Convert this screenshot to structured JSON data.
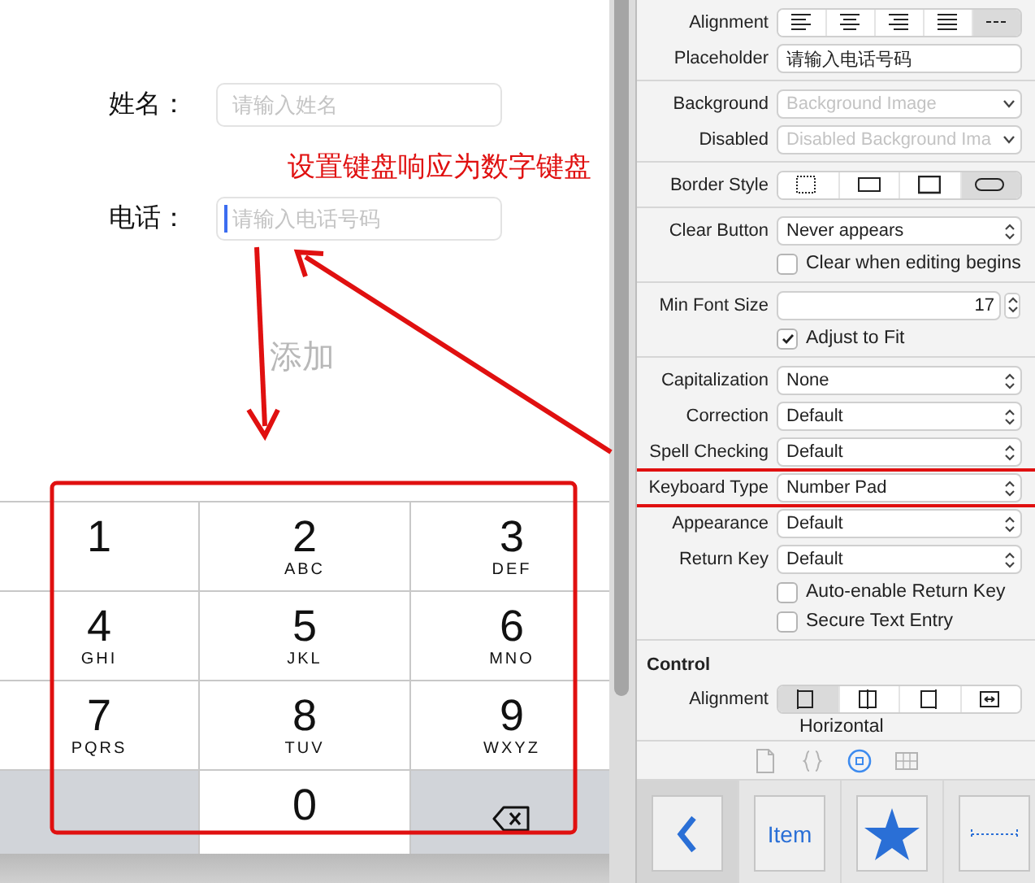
{
  "simulator": {
    "fields": [
      {
        "label": "姓名：",
        "placeholder": "请输入姓名",
        "focused": false
      },
      {
        "label": "电话：",
        "placeholder": "请输入电话号码",
        "focused": true
      }
    ],
    "add_button": "添加",
    "keypad": [
      {
        "kind": "digit",
        "digit": "1"
      },
      {
        "kind": "digit",
        "digit": "2",
        "letters": "ABC"
      },
      {
        "kind": "digit",
        "digit": "3",
        "letters": "DEF"
      },
      {
        "kind": "digit",
        "digit": "4",
        "letters": "GHI"
      },
      {
        "kind": "digit",
        "digit": "5",
        "letters": "JKL"
      },
      {
        "kind": "digit",
        "digit": "6",
        "letters": "MNO"
      },
      {
        "kind": "digit",
        "digit": "7",
        "letters": "PQRS"
      },
      {
        "kind": "digit",
        "digit": "8",
        "letters": "TUV"
      },
      {
        "kind": "digit",
        "digit": "9",
        "letters": "WXYZ"
      },
      {
        "kind": "blank"
      },
      {
        "kind": "digit",
        "digit": "0"
      },
      {
        "kind": "delete"
      }
    ]
  },
  "annotation": {
    "text": "设置键盘响应为数字键盘"
  },
  "inspector": {
    "sections": [
      {
        "rows": [
          {
            "kind": "segmented",
            "label": "Alignment",
            "segments": [
              {
                "selected": false
              },
              {
                "selected": false
              },
              {
                "selected": false
              },
              {
                "selected": false
              },
              {
                "selected": true
              }
            ]
          },
          {
            "kind": "text",
            "label": "Placeholder",
            "value": "请输入电话号码"
          }
        ]
      },
      {
        "rows": [
          {
            "kind": "combo",
            "label": "Background",
            "placeholder": "Background Image"
          },
          {
            "kind": "combo",
            "label": "Disabled",
            "placeholder": "Disabled Background Ima"
          }
        ]
      },
      {
        "rows": [
          {
            "kind": "segmented",
            "label": "Border Style",
            "segments": [
              {
                "selected": false
              },
              {
                "selected": false
              },
              {
                "selected": false
              },
              {
                "selected": true
              }
            ]
          }
        ]
      },
      {
        "rows": [
          {
            "kind": "popup",
            "label": "Clear Button",
            "value": "Never appears",
            "annotated": false
          },
          {
            "kind": "checkbox",
            "label": "Clear when editing begins",
            "checked": false
          }
        ]
      },
      {
        "rows": [
          {
            "kind": "stepper",
            "label": "Min Font Size",
            "value": "17"
          },
          {
            "kind": "checkbox",
            "label": "Adjust to Fit",
            "checked": true
          }
        ]
      },
      {
        "rows": [
          {
            "kind": "popup",
            "label": "Capitalization",
            "value": "None",
            "annotated": false
          },
          {
            "kind": "popup",
            "label": "Correction",
            "value": "Default",
            "annotated": false
          },
          {
            "kind": "popup",
            "label": "Spell Checking",
            "value": "Default",
            "annotated": false
          },
          {
            "kind": "popup",
            "label": "Keyboard Type",
            "value": "Number Pad",
            "annotated": true
          },
          {
            "kind": "popup",
            "label": "Appearance",
            "value": "Default",
            "annotated": false
          },
          {
            "kind": "popup",
            "label": "Return Key",
            "value": "Default",
            "annotated": false
          },
          {
            "kind": "checkbox",
            "label": "Auto-enable Return Key",
            "checked": false
          },
          {
            "kind": "checkbox",
            "label": "Secure Text Entry",
            "checked": false
          }
        ]
      },
      {
        "title": "Control",
        "rows": [
          {
            "kind": "segmented",
            "label": "Alignment",
            "caption": "Horizontal",
            "segments": [
              {
                "selected": true
              },
              {
                "selected": false
              },
              {
                "selected": false
              },
              {
                "selected": false
              }
            ]
          }
        ]
      }
    ],
    "toolbar": [
      {
        "selected": false
      },
      {
        "selected": false
      },
      {
        "selected": true
      },
      {
        "selected": false
      }
    ],
    "library": [
      {
        "selected": true
      },
      {
        "selected": false,
        "label": "Item"
      },
      {
        "selected": false
      },
      {
        "selected": false
      }
    ]
  }
}
